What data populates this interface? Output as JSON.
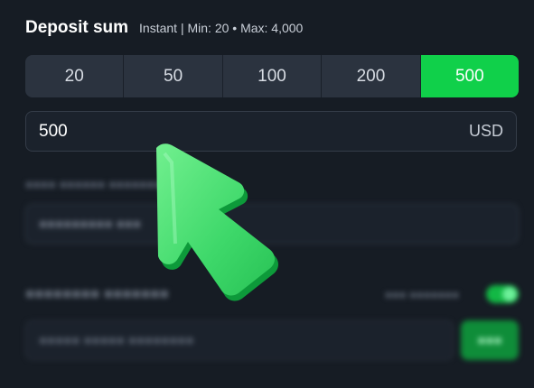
{
  "deposit": {
    "title": "Deposit sum",
    "limits": "Instant | Min: 20 • Max: 4,000",
    "amounts": [
      "20",
      "50",
      "100",
      "200",
      "500"
    ],
    "selected_amount": "500",
    "amount_value": "500",
    "currency": "USD"
  },
  "colors": {
    "accent": "#10d04a",
    "background": "#161c24",
    "button_bg": "#2b333f"
  },
  "overlay": {
    "cursor_icon": "arrow-pointer-icon"
  }
}
